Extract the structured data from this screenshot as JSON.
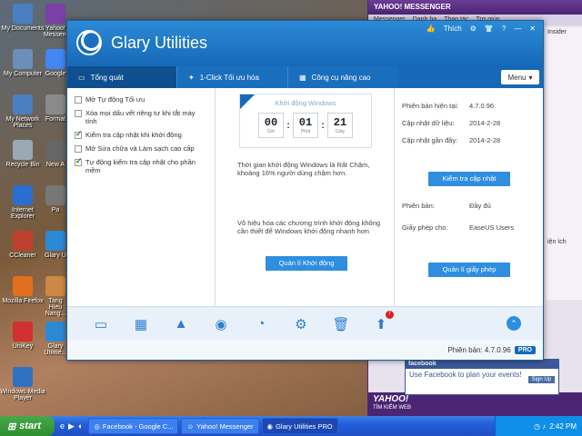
{
  "desktop": {
    "icons_col1": [
      {
        "label": "My Documents",
        "color": "#4a7fc1"
      },
      {
        "label": "My Computer",
        "color": "#6b8fb8"
      },
      {
        "label": "My Network Places",
        "color": "#4a7fc1"
      },
      {
        "label": "Recycle Bin",
        "color": "#9aa8b5"
      },
      {
        "label": "Internet Explorer",
        "color": "#2a6fd0"
      },
      {
        "label": "CCleaner",
        "color": "#c04030"
      },
      {
        "label": "Mozilla Firefox",
        "color": "#e07020"
      },
      {
        "label": "UniKey",
        "color": "#d03030"
      },
      {
        "label": "Windows Media Player",
        "color": "#3070c0"
      }
    ],
    "icons_col2": [
      {
        "label": "Yahoo! Messenger",
        "color": "#7b3fa8"
      },
      {
        "label": "Google",
        "color": "#4285f4"
      },
      {
        "label": "Format",
        "color": "#8a8a8a"
      },
      {
        "label": "New A",
        "color": "#666666"
      },
      {
        "label": "Pa",
        "color": "#777777"
      },
      {
        "label": "Glary U",
        "color": "#2b8ad6"
      },
      {
        "label": "Tang Hieu Nang...",
        "color": "#cc8844"
      },
      {
        "label": "Glary Utilitie...",
        "color": "#2b8ad6"
      }
    ]
  },
  "yahoo": {
    "title": "YAHOO! MESSENGER",
    "menu": [
      "Messenger",
      "Danh ba",
      "Thao tác",
      "Trợ giúp"
    ],
    "insider": "Insider",
    "side_text": "iện ích",
    "fb_head": "facebook",
    "fb_text": "Use Facebook to plan your events!",
    "fb_signup": "Sign Up",
    "logo": "YAHOO!",
    "logo_sub": "TÌM KIẾM WEB"
  },
  "glary": {
    "title": "Glary Utilities",
    "topbar": {
      "like": "Thích",
      "like_icon": "thumb-up-icon"
    },
    "tabs": [
      {
        "label": "Tổng quát",
        "icon": "monitor-icon"
      },
      {
        "label": "1-Click Tối ưu hóa",
        "icon": "wand-icon"
      },
      {
        "label": "Công cụ nâng cao",
        "icon": "grid-icon"
      }
    ],
    "menu_label": "Menu",
    "options": [
      {
        "label": "Mở Tự động Tối ưu",
        "checked": false
      },
      {
        "label": "Xóa mọi dấu vết riêng tư khi tắt máy tính",
        "checked": false
      },
      {
        "label": "Kiểm tra cập nhật khi khởi động",
        "checked": true
      },
      {
        "label": "Mở Sửa chữa và Làm sạch cao cấp",
        "checked": false
      },
      {
        "label": "Tự động kiểm tra cập nhật cho phần mềm",
        "checked": true
      }
    ],
    "boot": {
      "title": "Khởi động Windows",
      "minutes": "00",
      "seconds": "01",
      "ms": "21",
      "lbl_min": "Giờ",
      "lbl_sec": "Phút",
      "lbl_ms": "Giây",
      "desc": "Thời gian khởi động Windows là Rất Chậm, khoảng 16% người dùng chậm hơn.",
      "disable_desc": "Vô hiệu hóa các chương trình khởi động không cần thiết để Windows khởi động nhanh hơn",
      "button": "Quản lí Khởi động"
    },
    "info": {
      "current_version_label": "Phiên bản hiện tại:",
      "current_version": "4.7.0.96",
      "data_update_label": "Cập nhật dữ liệu:",
      "data_update": "2014-2-28",
      "last_update_label": "Cập nhật gần đây:",
      "last_update": "2014-2-28",
      "check_button": "Kiểm tra cập nhật",
      "edition_label": "Phiên bản:",
      "edition": "Đầy đủ",
      "license_label": "Giấy phép cho:",
      "license": "EaseUS Users",
      "license_button": "Quản lí giấy phép"
    },
    "toolbar_badge": "!",
    "status_label": "Phiên bản: 4.7.0.96",
    "pro": "PRO"
  },
  "taskbar": {
    "start": "start",
    "buttons": [
      {
        "label": "Facebook - Google C...",
        "icon": "chrome-icon"
      },
      {
        "label": "Yahoo! Messenger",
        "icon": "yahoo-icon"
      },
      {
        "label": "Glary Utilities PRO",
        "icon": "glary-icon"
      }
    ],
    "clock": "2:42 PM"
  }
}
